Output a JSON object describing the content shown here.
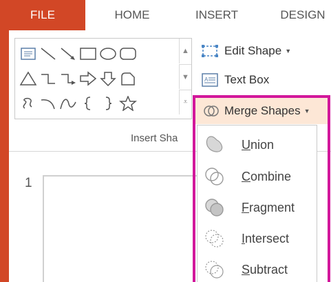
{
  "tabs": {
    "file": "FILE",
    "home": "HOME",
    "insert": "INSERT",
    "design": "DESIGN"
  },
  "ribbon": {
    "edit_shape": "Edit Shape",
    "text_box": "Text Box",
    "merge_shapes": "Merge Shapes",
    "group_label": "Insert Sha"
  },
  "slide": {
    "number": "1"
  },
  "menu": {
    "items": [
      {
        "first": "U",
        "rest": "nion",
        "icon": "union-icon"
      },
      {
        "first": "C",
        "rest": "ombine",
        "icon": "combine-icon"
      },
      {
        "first": "F",
        "rest": "ragment",
        "icon": "fragment-icon"
      },
      {
        "first": "I",
        "rest": "ntersect",
        "icon": "intersect-icon"
      },
      {
        "first": "S",
        "rest": "ubtract",
        "icon": "subtract-icon"
      }
    ]
  },
  "colors": {
    "file_tab": "#d24726",
    "highlight_frame": "#d2179b",
    "hover_bg": "#fde7d6"
  }
}
